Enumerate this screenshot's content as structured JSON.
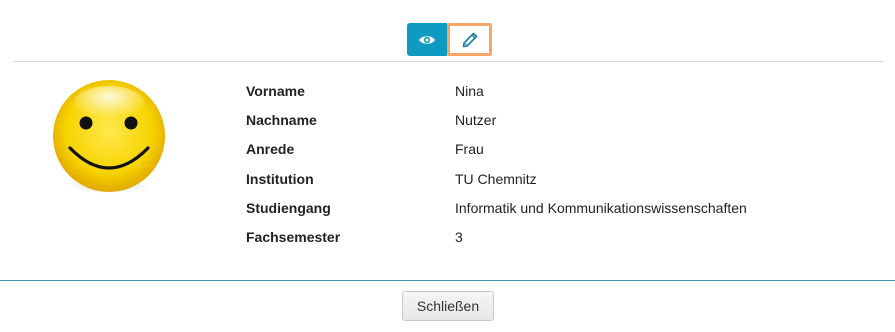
{
  "mode_toggle": {
    "view_icon": "eye-icon",
    "edit_icon": "pencil-icon",
    "active": "edit",
    "view_color": "#0f9ac2",
    "edit_highlight_color": "#f5a668"
  },
  "avatar": {
    "icon": "smiley-face-icon",
    "color": "#f7d300"
  },
  "profile": {
    "fields": [
      {
        "label": "Vorname",
        "value": "Nina"
      },
      {
        "label": "Nachname",
        "value": "Nutzer"
      },
      {
        "label": "Anrede",
        "value": "Frau"
      },
      {
        "label": "Institution",
        "value": "TU Chemnitz"
      },
      {
        "label": "Studiengang",
        "value": "Informatik und Kommunikationswissenschaften"
      },
      {
        "label": "Fachsemester",
        "value": "3"
      }
    ]
  },
  "footer": {
    "close_label": "Schließen"
  }
}
